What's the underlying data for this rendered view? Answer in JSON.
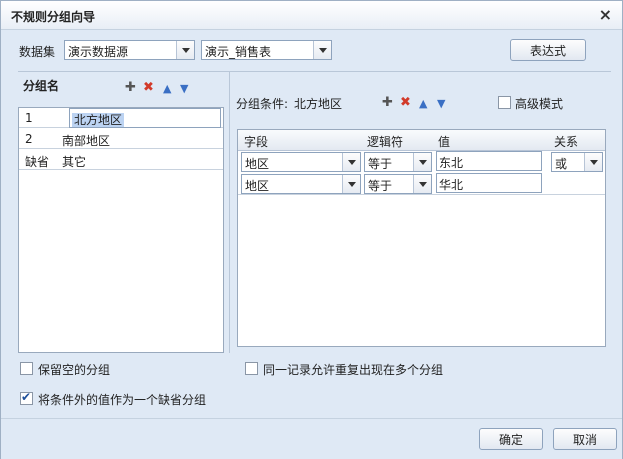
{
  "window": {
    "title": "不规则分组向导",
    "close_icon": "close-icon"
  },
  "top": {
    "datasource_label": "数据集",
    "datasource_value": "演示数据源",
    "table_value": "演示_销售表",
    "expression_button": "表达式"
  },
  "left": {
    "header": "分组名",
    "groups": [
      {
        "index": "1",
        "name": "北方地区"
      },
      {
        "index": "2",
        "name": "南部地区"
      },
      {
        "index": "缺省",
        "name": "其它"
      }
    ]
  },
  "right": {
    "condition_label": "分组条件:",
    "condition_group": "北方地区",
    "advanced_label": "高级模式",
    "columns": [
      "字段",
      "逻辑符",
      "值",
      "关系"
    ],
    "rows": [
      {
        "field": "地区",
        "op": "等于",
        "value": "东北",
        "relation": "或"
      },
      {
        "field": "地区",
        "op": "等于",
        "value": "华北",
        "relation": ""
      }
    ]
  },
  "options": {
    "keep_empty": "保留空的分组",
    "allow_duplicate": "同一记录允许重复出现在多个分组",
    "default_group": "将条件外的值作为一个缺省分组",
    "default_group_checked": true
  },
  "buttons": {
    "ok": "确定",
    "cancel": "取消"
  }
}
